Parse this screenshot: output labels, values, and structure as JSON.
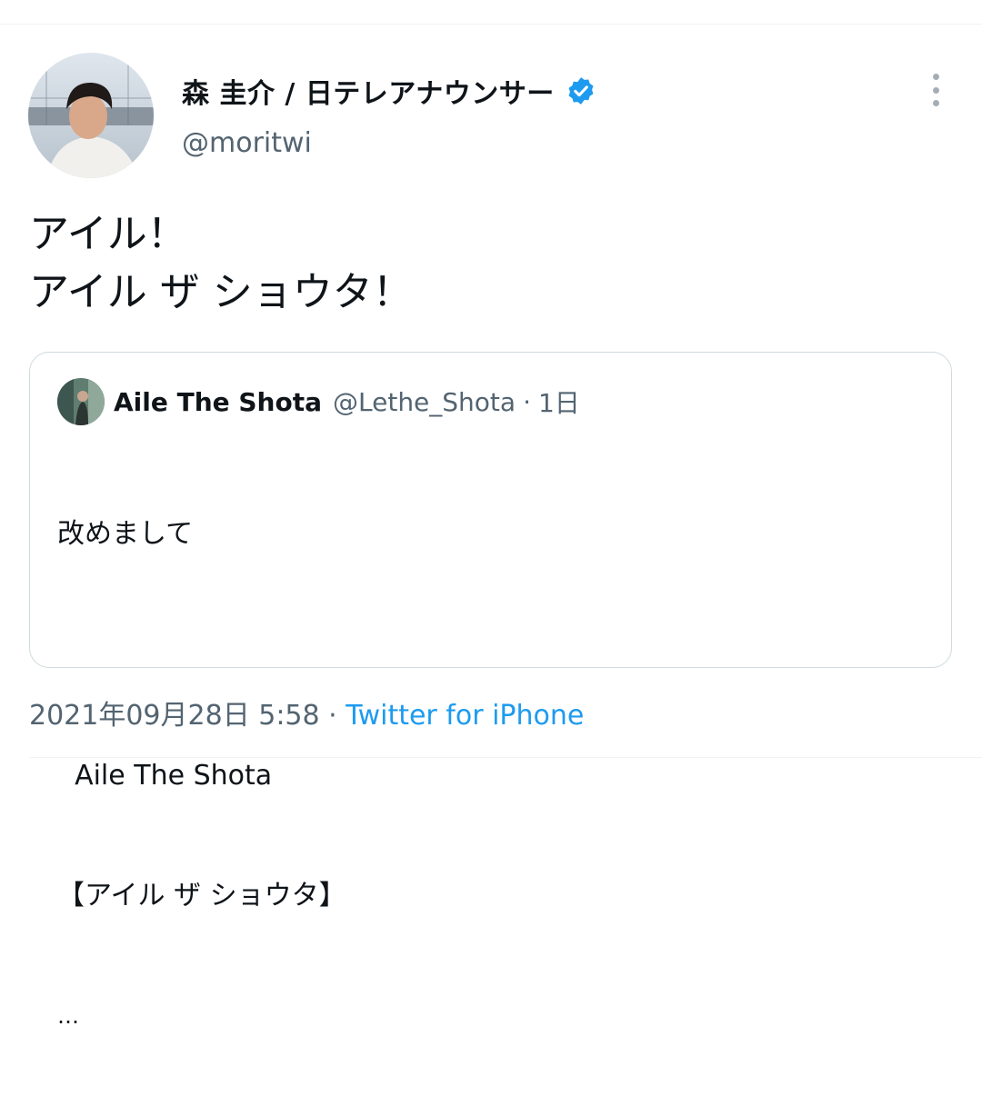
{
  "author": {
    "display_name": "森 圭介 / 日テレアナウンサー",
    "handle": "@moritwi",
    "verified": true,
    "avatar_icon": "profile-photo"
  },
  "menu_icon": "more-vertical-icon",
  "tweet": {
    "line1": "アイル！",
    "line2": "アイル ザ ショウタ！"
  },
  "quote": {
    "name": "Aile The Shota",
    "handle": "@Lethe_Shota",
    "separator": "·",
    "time": "1日",
    "line1": "改めまして",
    "line2": "  Aile The Shota",
    "line3": "【アイル ザ ショウタ】",
    "line4": "…"
  },
  "meta": {
    "timestamp": "2021年09月28日 5:58",
    "separator": " · ",
    "source": "Twitter for iPhone"
  },
  "colors": {
    "text": "#0f1419",
    "secondary": "#536471",
    "link": "#1d9bf0",
    "border": "#cfd9de"
  }
}
